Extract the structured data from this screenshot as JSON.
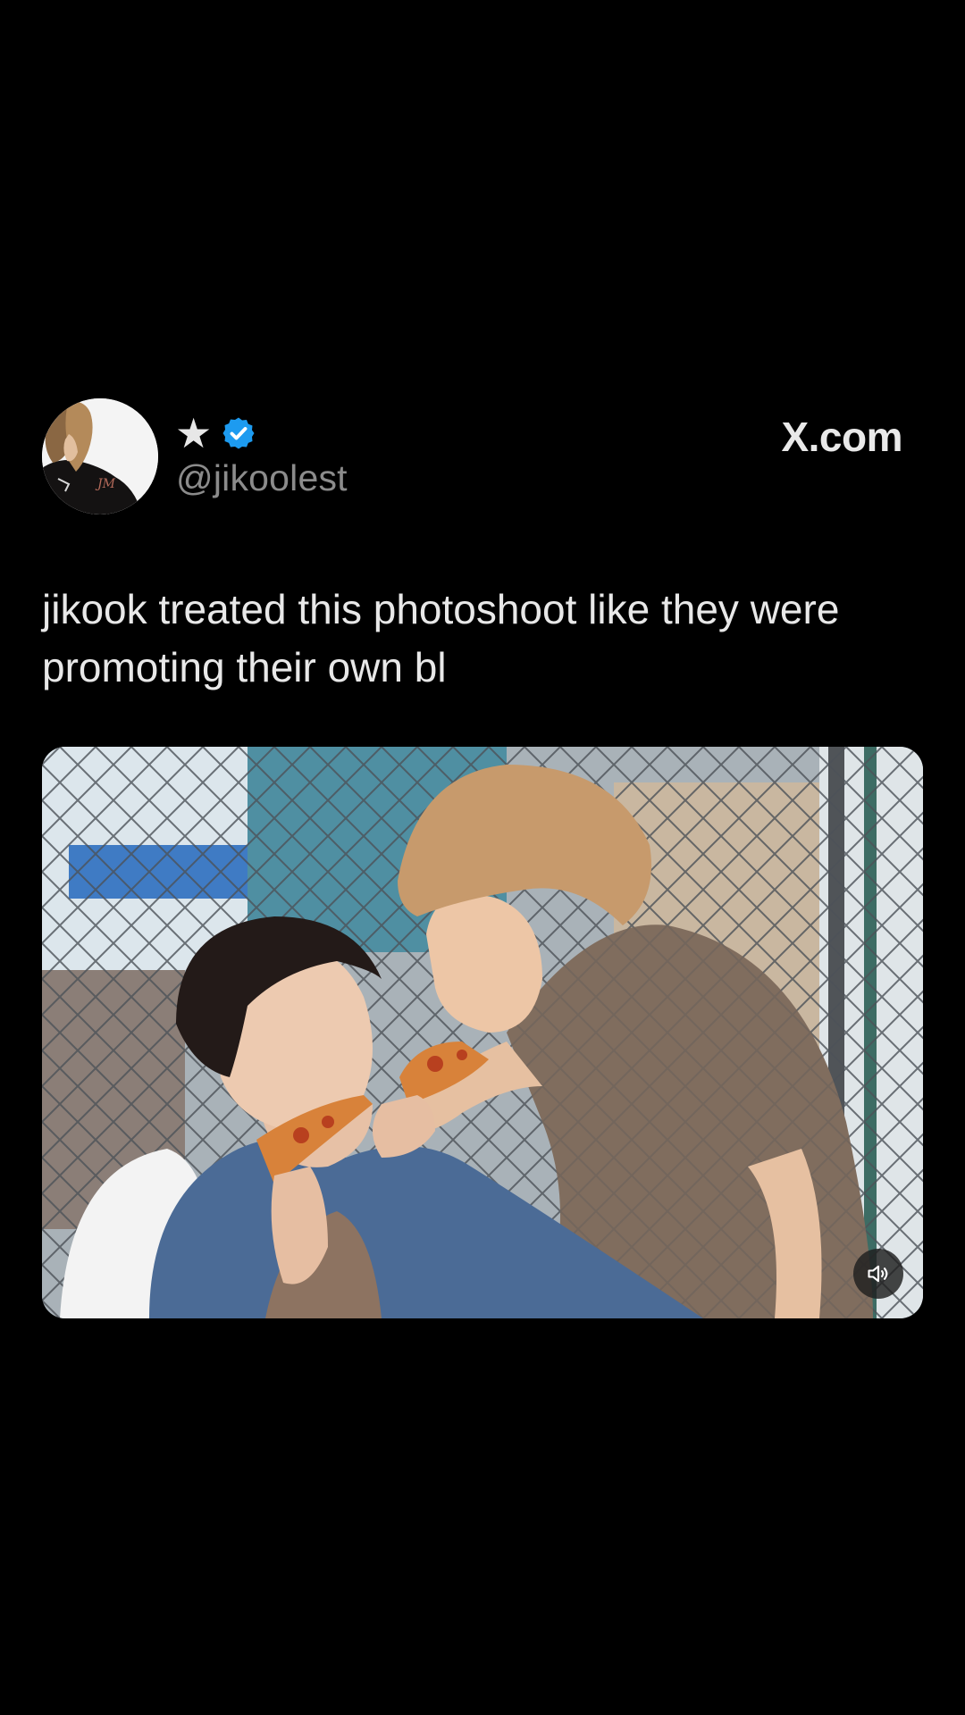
{
  "post": {
    "author": {
      "display_name": "★",
      "handle": "@jikoolest",
      "verified": true,
      "verified_badge_color": "#1d9bf0",
      "avatar_icon": "profile-photo"
    },
    "source_label": "X.com",
    "text": "jikook treated this photoshoot like they were promoting their own bl",
    "media": {
      "type": "video",
      "sound_icon": "speaker-icon"
    }
  }
}
